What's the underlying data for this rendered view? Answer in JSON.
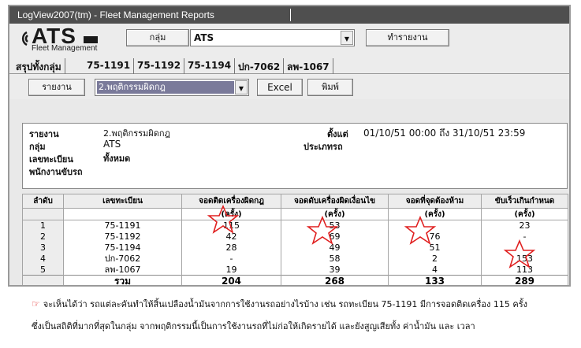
{
  "window": {
    "title": "LogView2007(tm) - Fleet Management Reports"
  },
  "logo": {
    "mark": "ATS",
    "subtitle": "Fleet Management"
  },
  "toolbar": {
    "group_label": "กลุ่ม",
    "group_value": "ATS",
    "report_button": "ทำรายงาน"
  },
  "tabs": [
    {
      "label": "สรุปทั้งกลุ่ม"
    },
    {
      "label": "75-1191"
    },
    {
      "label": "75-1192"
    },
    {
      "label": "75-1194"
    },
    {
      "label": "ปก-7062"
    },
    {
      "label": "ลพ-1067"
    }
  ],
  "report_bar": {
    "report_label": "รายงาน",
    "report_value": "2.พฤติกรรมผิดกฎ",
    "excel": "Excel",
    "print": "พิมพ์"
  },
  "info": {
    "report_key": "รายงาน",
    "report_val": "2.พฤติกรรมผิดกฎ",
    "group_key": "กลุ่ม",
    "group_val": "ATS",
    "plate_key": "เลขทะเบียน",
    "plate_val": "ทั้งหมด",
    "driver_key": "พนักงานขับรถ",
    "since_key": "ตั้งแต่",
    "since_val": "01/10/51  00:00 ถึง 31/10/51  23:59",
    "type_key": "ประเภทรถ"
  },
  "table": {
    "headers": [
      "ลำดับ",
      "เลขทะเบียน",
      "จอดติดเครื่องผิดกฎ",
      "จอดดับเครื่องผิดเงื่อนไข",
      "จอดที่จุดต้องห้าม",
      "ขับเร็วเกินกำหนด"
    ],
    "unit": "(ครั้ง)",
    "rows": [
      [
        "1",
        "75-1191",
        "115",
        "53",
        "",
        "23"
      ],
      [
        "2",
        "75-1192",
        "42",
        "69",
        "76",
        "-"
      ],
      [
        "3",
        "75-1194",
        "28",
        "49",
        "51",
        ""
      ],
      [
        "4",
        "ปก-7062",
        "-",
        "58",
        "2",
        "153"
      ],
      [
        "5",
        "ลพ-1067",
        "19",
        "39",
        "4",
        "113"
      ]
    ],
    "total_label": "รวม",
    "totals": [
      "204",
      "268",
      "133",
      "289"
    ]
  },
  "caption": {
    "line1": "จะเห็นได้ว่า รถแต่ละคันทำให้สิ้นเปลืองน้ำมันจากการใช้งานรถอย่างไรบ้าง เช่น รถทะเบียน 75-1191 มีการจอดติดเครื่อง 115 ครั้ง",
    "line2": "ซึ่งเป็นสถิติที่มากที่สุดในกลุ่ม จากพฤติกรรมนี้เป็นการใช้งานรถที่ไม่ก่อให้เกิดรายได้ และยังสูญเสียทั้ง ค่าน้ำมัน และ เวลา"
  },
  "colors": {
    "titlebar": "#4f4f4f",
    "star": "#e02020",
    "selection": "#7a7a9a"
  }
}
